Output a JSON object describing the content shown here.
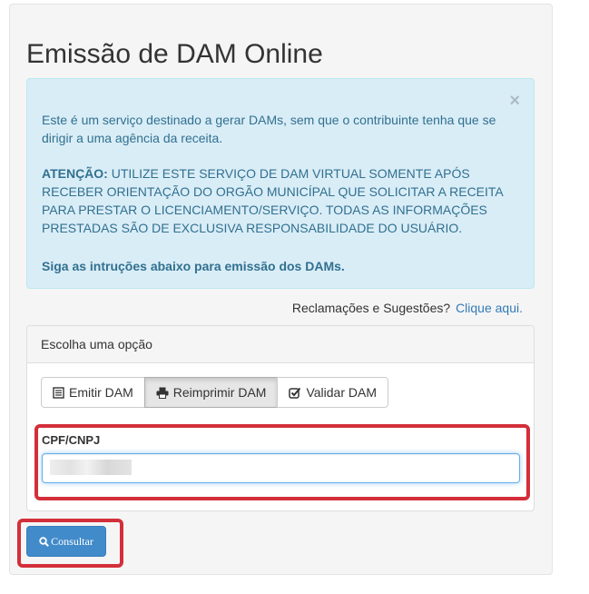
{
  "page": {
    "title": "Emissão de DAM Online"
  },
  "alert": {
    "close_label": "×",
    "intro": "Este é um serviço destinado a gerar DAMs, sem que o contribuinte tenha que se dirigir a uma agência da receita.",
    "warning_label": "ATENÇÃO:",
    "warning_text": " UTILIZE ESTE SERVIÇO DE DAM VIRTUAL SOMENTE APÓS RECEBER ORIENTAÇÃO DO ORGÃO MUNICÍPAL QUE SOLICITAR A RECEITA PARA PRESTAR O LICENCIAMENTO/SERVIÇO. TODAS AS INFORMAÇÕES PRESTADAS SÃO DE EXCLUSIVA RESPONSABILIDADE DO USUÁRIO.",
    "instructions": "Siga as intruções abaixo para emissão dos DAMs."
  },
  "feedback": {
    "text": "Reclamações e Sugestões?",
    "link": "Clique aqui."
  },
  "panel": {
    "heading": "Escolha uma opção",
    "options": [
      {
        "label": "Emitir DAM",
        "icon": "list-alt-icon",
        "active": false
      },
      {
        "label": "Reimprimir DAM",
        "icon": "print-icon",
        "active": true
      },
      {
        "label": "Validar DAM",
        "icon": "check-square-icon",
        "active": false
      }
    ],
    "cpf_label": "CPF/CNPJ",
    "cpf_value": ""
  },
  "submit": {
    "label": "Consultar",
    "icon": "search-icon"
  },
  "colors": {
    "alert_bg": "#d9edf7",
    "alert_text": "#31708f",
    "primary": "#428bca",
    "highlight": "#d32f3a"
  }
}
